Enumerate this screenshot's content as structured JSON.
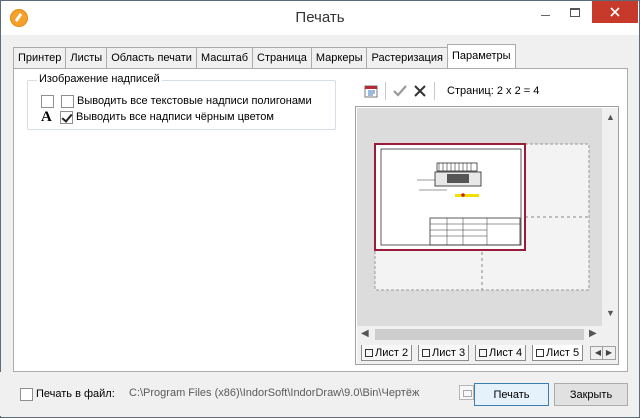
{
  "window": {
    "title": "Печать"
  },
  "tabs": [
    "Принтер",
    "Листы",
    "Область печати",
    "Масштаб",
    "Страница",
    "Маркеры",
    "Растеризация",
    "Параметры"
  ],
  "active_tab": "Параметры",
  "labels_group": {
    "title": "Изображение надписей",
    "options": [
      {
        "label": "Выводить все текстовые надписи полигонами",
        "checked": false
      },
      {
        "label": "Выводить все надписи чёрным цветом",
        "checked": true
      }
    ],
    "letter_icon": "A"
  },
  "preview": {
    "toolbar_icons": [
      "page-setup-icon",
      "check-icon",
      "cross-icon"
    ],
    "pages_text": "Страниц: 2 x 2 = 4",
    "sheet_tabs": [
      "Лист 2",
      "Лист 3",
      "Лист 4",
      "Лист 5"
    ],
    "active_sheet": "Лист 5"
  },
  "footer": {
    "print_to_file_label": "Печать в файл:",
    "print_to_file_checked": false,
    "file_path": "C:\\Program Files (x86)\\IndorSoft\\IndorDraw\\9.0\\Bin\\Чертёж",
    "print_button": "Печать",
    "close_button": "Закрыть"
  },
  "colors": {
    "close_button": "#c7392b",
    "accent": "#3c7fb1",
    "drawing_frame": "#9b1b3a"
  }
}
